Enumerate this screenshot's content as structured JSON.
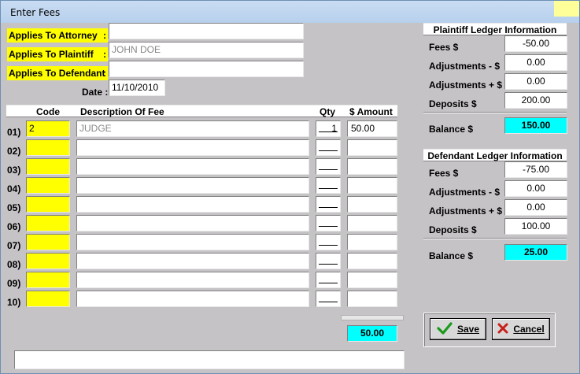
{
  "window": {
    "title": "Enter Fees"
  },
  "form": {
    "attorney_label": "Applies To Attorney",
    "plaintiff_label": "Applies To Plaintiff",
    "defendant_label": "Applies To Defendant",
    "colon": ":",
    "attorney_value": "",
    "plaintiff_value": "JOHN DOE",
    "defendant_value": "",
    "date_label": "Date :",
    "date_value": "11/10/2010"
  },
  "fees_table": {
    "headers": {
      "code": "Code",
      "description": "Description Of Fee",
      "qty": "Qty",
      "amount": "$ Amount"
    },
    "rows": [
      {
        "num": "01)",
        "code": "2",
        "description": "JUDGE",
        "qty": "1",
        "amount": "50.00"
      },
      {
        "num": "02)",
        "code": "",
        "description": "",
        "qty": "",
        "amount": ""
      },
      {
        "num": "03)",
        "code": "",
        "description": "",
        "qty": "",
        "amount": ""
      },
      {
        "num": "04)",
        "code": "",
        "description": "",
        "qty": "",
        "amount": ""
      },
      {
        "num": "05)",
        "code": "",
        "description": "",
        "qty": "",
        "amount": ""
      },
      {
        "num": "06)",
        "code": "",
        "description": "",
        "qty": "",
        "amount": ""
      },
      {
        "num": "07)",
        "code": "",
        "description": "",
        "qty": "",
        "amount": ""
      },
      {
        "num": "08)",
        "code": "",
        "description": "",
        "qty": "",
        "amount": ""
      },
      {
        "num": "09)",
        "code": "",
        "description": "",
        "qty": "",
        "amount": ""
      },
      {
        "num": "10)",
        "code": "",
        "description": "",
        "qty": "",
        "amount": ""
      }
    ],
    "total": "50.00"
  },
  "plaintiff_ledger": {
    "title": "Plaintiff Ledger Information",
    "fees_label": "Fees $",
    "fees": "-50.00",
    "adj_minus_label": "Adjustments - $",
    "adj_minus": "0.00",
    "adj_plus_label": "Adjustments + $",
    "adj_plus": "0.00",
    "deposits_label": "Deposits $",
    "deposits": "200.00",
    "balance_label": "Balance $",
    "balance": "150.00"
  },
  "defendant_ledger": {
    "title": "Defendant Ledger Information",
    "fees_label": "Fees $",
    "fees": "-75.00",
    "adj_minus_label": "Adjustments - $",
    "adj_minus": "0.00",
    "adj_plus_label": "Adjustments + $",
    "adj_plus": "0.00",
    "deposits_label": "Deposits $",
    "deposits": "100.00",
    "balance_label": "Balance $",
    "balance": "25.00"
  },
  "buttons": {
    "save": "Save",
    "cancel": "Cancel"
  },
  "status": {
    "message": ""
  },
  "colors": {
    "highlight": "#ffff00",
    "balance": "#00ffff",
    "window": "#c6c3c6"
  }
}
